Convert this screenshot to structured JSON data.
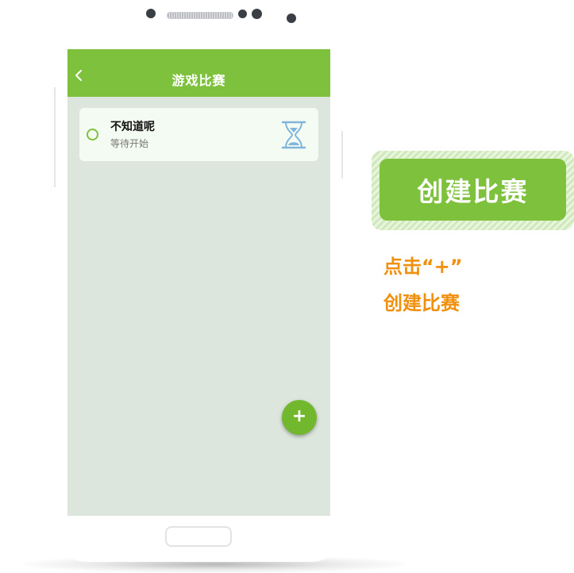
{
  "app": {
    "title": "游戏比赛"
  },
  "list": {
    "items": [
      {
        "title": "不知道呢",
        "status": "等待开始",
        "status_icon": "hourglass-icon"
      }
    ]
  },
  "fab": {
    "label": "+"
  },
  "callout": {
    "button_label": "创建比赛",
    "hint_line1": "点击“+”",
    "hint_line2": "创建比赛"
  },
  "colors": {
    "accent_green": "#7dc13c",
    "screen_background": "#dde6dc",
    "card_background": "#f4fbf2",
    "hint_orange": "#f0900e"
  }
}
